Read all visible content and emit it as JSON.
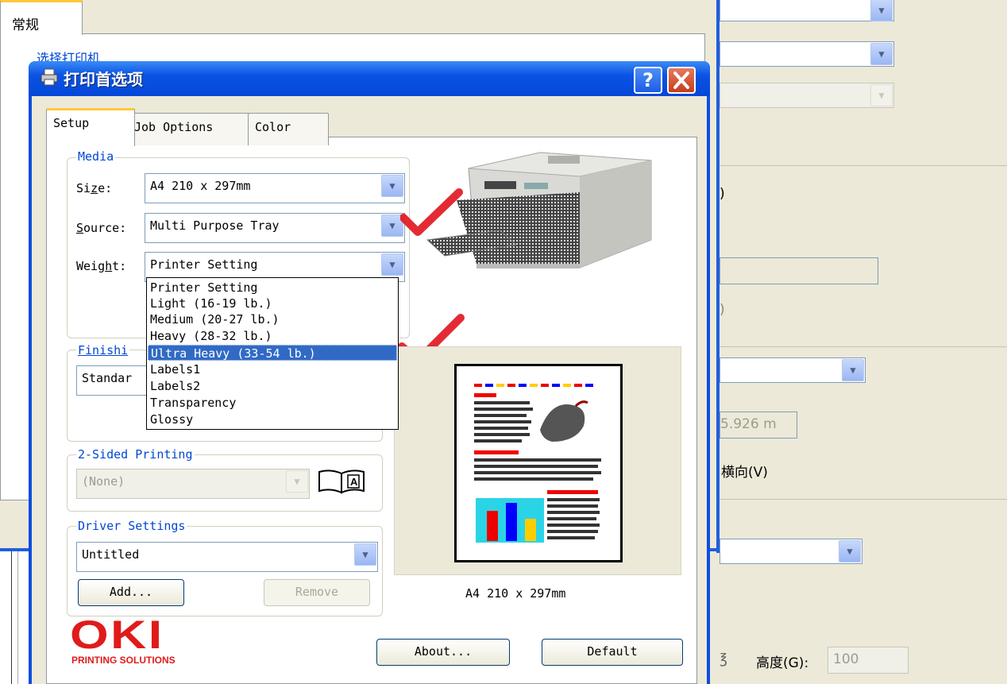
{
  "background_window": {
    "tab_label": "常规",
    "select_printer_label": "选择打印机",
    "right_fragments": {
      "paren": ")",
      "paren2": ")",
      "measure_value": "5.926 m",
      "orientation_label": "横向(V)",
      "height_label": "高度(G):",
      "height_value": "100"
    }
  },
  "dialog": {
    "title": "打印首选项",
    "help_label": "?",
    "tabs": [
      "Setup",
      "Job Options",
      "Color"
    ],
    "media": {
      "legend": "Media",
      "size_label": "Size:",
      "size_value": "A4 210 x 297mm",
      "source_label": "Source:",
      "source_value": "Multi Purpose Tray",
      "weight_label": "Weight:",
      "weight_value": "Printer Setting",
      "weight_options": [
        "Printer Setting",
        "Light (16-19 lb.)",
        "Medium (20-27 lb.)",
        "Heavy (28-32 lb.)",
        "Ultra Heavy (33-54 lb.)",
        "Labels1",
        "Labels2",
        "Transparency",
        "Glossy"
      ],
      "weight_selected_index": 4
    },
    "finishing": {
      "legend": "Finishi",
      "value": "Standar"
    },
    "two_sided": {
      "legend": "2-Sided Printing",
      "value": "(None)"
    },
    "driver_settings": {
      "legend": "Driver Settings",
      "value": "Untitled",
      "add_label": "Add...",
      "remove_label": "Remove"
    },
    "preview_caption": "A4 210 x 297mm",
    "about_label": "About...",
    "default_label": "Default",
    "brand": {
      "logo_text": "OKI",
      "tagline": "PRINTING SOLUTIONS",
      "color": "#e01b1b"
    }
  },
  "colors": {
    "titlebar": "#0b53e4",
    "link_blue": "#0046d5",
    "selection": "#316ac5",
    "check_red": "#e0141e"
  }
}
